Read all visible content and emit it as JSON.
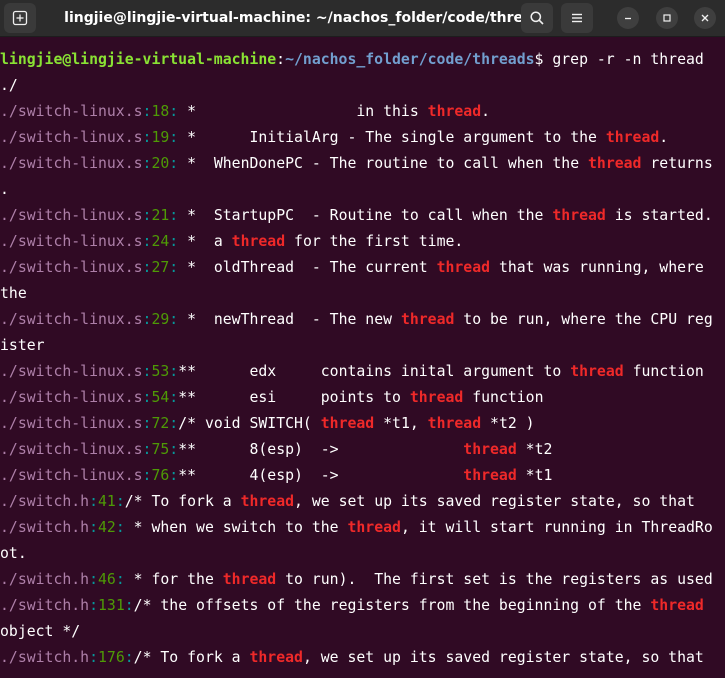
{
  "window": {
    "title": "lingjie@lingjie-virtual-machine: ~/nachos_folder/code/threads"
  },
  "icons": {
    "new_tab": "new-tab-icon",
    "search": "search-icon",
    "menu": "hamburger-menu-icon",
    "minimize": "minimize-icon",
    "maximize": "maximize-icon",
    "close": "close-icon"
  },
  "colors": {
    "background": "#300a24",
    "titlebar": "#2c2c2c",
    "filename": "#ad7fa8",
    "separator": "#06989a",
    "line_number": "#4e9a06",
    "match": "#ef2929",
    "prompt_user": "#8ae234",
    "prompt_path": "#729fcf"
  },
  "terminal": {
    "lines": [
      [
        {
          "t": "lingjie@lingjie-virtual-machine",
          "c": "user"
        },
        {
          "t": ":",
          "c": "plain"
        },
        {
          "t": "~/nachos_folder/code/threads",
          "c": "path"
        },
        {
          "t": "$ grep -r -n thread",
          "c": "plain"
        }
      ],
      [
        {
          "t": "./",
          "c": "plain"
        }
      ],
      [
        {
          "t": "./switch-linux.s",
          "c": "file"
        },
        {
          "t": ":",
          "c": "sep"
        },
        {
          "t": "18",
          "c": "num"
        },
        {
          "t": ":",
          "c": "sep"
        },
        {
          "t": " *                  in this ",
          "c": "plain"
        },
        {
          "t": "thread",
          "c": "match"
        },
        {
          "t": ".",
          "c": "plain"
        }
      ],
      [
        {
          "t": "./switch-linux.s",
          "c": "file"
        },
        {
          "t": ":",
          "c": "sep"
        },
        {
          "t": "19",
          "c": "num"
        },
        {
          "t": ":",
          "c": "sep"
        },
        {
          "t": " *      InitialArg - The single argument to the ",
          "c": "plain"
        },
        {
          "t": "thread",
          "c": "match"
        },
        {
          "t": ".",
          "c": "plain"
        }
      ],
      [
        {
          "t": "./switch-linux.s",
          "c": "file"
        },
        {
          "t": ":",
          "c": "sep"
        },
        {
          "t": "20",
          "c": "num"
        },
        {
          "t": ":",
          "c": "sep"
        },
        {
          "t": " *  WhenDonePC - The routine to call when the ",
          "c": "plain"
        },
        {
          "t": "thread",
          "c": "match"
        },
        {
          "t": " returns",
          "c": "plain"
        }
      ],
      [
        {
          "t": ".",
          "c": "plain"
        }
      ],
      [
        {
          "t": "./switch-linux.s",
          "c": "file"
        },
        {
          "t": ":",
          "c": "sep"
        },
        {
          "t": "21",
          "c": "num"
        },
        {
          "t": ":",
          "c": "sep"
        },
        {
          "t": " *  StartupPC  - Routine to call when the ",
          "c": "plain"
        },
        {
          "t": "thread",
          "c": "match"
        },
        {
          "t": " is started.",
          "c": "plain"
        }
      ],
      [
        {
          "t": "./switch-linux.s",
          "c": "file"
        },
        {
          "t": ":",
          "c": "sep"
        },
        {
          "t": "24",
          "c": "num"
        },
        {
          "t": ":",
          "c": "sep"
        },
        {
          "t": " *  a ",
          "c": "plain"
        },
        {
          "t": "thread",
          "c": "match"
        },
        {
          "t": " for the first time.",
          "c": "plain"
        }
      ],
      [
        {
          "t": "./switch-linux.s",
          "c": "file"
        },
        {
          "t": ":",
          "c": "sep"
        },
        {
          "t": "27",
          "c": "num"
        },
        {
          "t": ":",
          "c": "sep"
        },
        {
          "t": " *  oldThread  - The current ",
          "c": "plain"
        },
        {
          "t": "thread",
          "c": "match"
        },
        {
          "t": " that was running, where",
          "c": "plain"
        }
      ],
      [
        {
          "t": "the",
          "c": "plain"
        }
      ],
      [
        {
          "t": "./switch-linux.s",
          "c": "file"
        },
        {
          "t": ":",
          "c": "sep"
        },
        {
          "t": "29",
          "c": "num"
        },
        {
          "t": ":",
          "c": "sep"
        },
        {
          "t": " *  newThread  - The new ",
          "c": "plain"
        },
        {
          "t": "thread",
          "c": "match"
        },
        {
          "t": " to be run, where the CPU reg",
          "c": "plain"
        }
      ],
      [
        {
          "t": "ister",
          "c": "plain"
        }
      ],
      [
        {
          "t": "./switch-linux.s",
          "c": "file"
        },
        {
          "t": ":",
          "c": "sep"
        },
        {
          "t": "53",
          "c": "num"
        },
        {
          "t": ":",
          "c": "sep"
        },
        {
          "t": "**      edx     contains inital argument to ",
          "c": "plain"
        },
        {
          "t": "thread",
          "c": "match"
        },
        {
          "t": " function",
          "c": "plain"
        }
      ],
      [
        {
          "t": "./switch-linux.s",
          "c": "file"
        },
        {
          "t": ":",
          "c": "sep"
        },
        {
          "t": "54",
          "c": "num"
        },
        {
          "t": ":",
          "c": "sep"
        },
        {
          "t": "**      esi     points to ",
          "c": "plain"
        },
        {
          "t": "thread",
          "c": "match"
        },
        {
          "t": " function",
          "c": "plain"
        }
      ],
      [
        {
          "t": "./switch-linux.s",
          "c": "file"
        },
        {
          "t": ":",
          "c": "sep"
        },
        {
          "t": "72",
          "c": "num"
        },
        {
          "t": ":",
          "c": "sep"
        },
        {
          "t": "/* void SWITCH( ",
          "c": "plain"
        },
        {
          "t": "thread",
          "c": "match"
        },
        {
          "t": " *t1, ",
          "c": "plain"
        },
        {
          "t": "thread",
          "c": "match"
        },
        {
          "t": " *t2 )",
          "c": "plain"
        }
      ],
      [
        {
          "t": "./switch-linux.s",
          "c": "file"
        },
        {
          "t": ":",
          "c": "sep"
        },
        {
          "t": "75",
          "c": "num"
        },
        {
          "t": ":",
          "c": "sep"
        },
        {
          "t": "**      8(esp)  ->              ",
          "c": "plain"
        },
        {
          "t": "thread",
          "c": "match"
        },
        {
          "t": " *t2",
          "c": "plain"
        }
      ],
      [
        {
          "t": "./switch-linux.s",
          "c": "file"
        },
        {
          "t": ":",
          "c": "sep"
        },
        {
          "t": "76",
          "c": "num"
        },
        {
          "t": ":",
          "c": "sep"
        },
        {
          "t": "**      4(esp)  ->              ",
          "c": "plain"
        },
        {
          "t": "thread",
          "c": "match"
        },
        {
          "t": " *t1",
          "c": "plain"
        }
      ],
      [
        {
          "t": "./switch.h",
          "c": "file"
        },
        {
          "t": ":",
          "c": "sep"
        },
        {
          "t": "41",
          "c": "num"
        },
        {
          "t": ":",
          "c": "sep"
        },
        {
          "t": "/* To fork a ",
          "c": "plain"
        },
        {
          "t": "thread",
          "c": "match"
        },
        {
          "t": ", we set up its saved register state, so that",
          "c": "plain"
        }
      ],
      [
        {
          "t": "./switch.h",
          "c": "file"
        },
        {
          "t": ":",
          "c": "sep"
        },
        {
          "t": "42",
          "c": "num"
        },
        {
          "t": ":",
          "c": "sep"
        },
        {
          "t": " * when we switch to the ",
          "c": "plain"
        },
        {
          "t": "thread",
          "c": "match"
        },
        {
          "t": ", it will start running in ThreadRo",
          "c": "plain"
        }
      ],
      [
        {
          "t": "ot.",
          "c": "plain"
        }
      ],
      [
        {
          "t": "./switch.h",
          "c": "file"
        },
        {
          "t": ":",
          "c": "sep"
        },
        {
          "t": "46",
          "c": "num"
        },
        {
          "t": ":",
          "c": "sep"
        },
        {
          "t": " * for the ",
          "c": "plain"
        },
        {
          "t": "thread",
          "c": "match"
        },
        {
          "t": " to run).  The first set is the registers as used",
          "c": "plain"
        }
      ],
      [
        {
          "t": "./switch.h",
          "c": "file"
        },
        {
          "t": ":",
          "c": "sep"
        },
        {
          "t": "131",
          "c": "num"
        },
        {
          "t": ":",
          "c": "sep"
        },
        {
          "t": "/* the offsets of the registers from the beginning of the ",
          "c": "plain"
        },
        {
          "t": "thread",
          "c": "match"
        }
      ],
      [
        {
          "t": "object */",
          "c": "plain"
        }
      ],
      [
        {
          "t": "./switch.h",
          "c": "file"
        },
        {
          "t": ":",
          "c": "sep"
        },
        {
          "t": "176",
          "c": "num"
        },
        {
          "t": ":",
          "c": "sep"
        },
        {
          "t": "/* To fork a ",
          "c": "plain"
        },
        {
          "t": "thread",
          "c": "match"
        },
        {
          "t": ", we set up its saved register state, so that",
          "c": "plain"
        }
      ]
    ]
  }
}
